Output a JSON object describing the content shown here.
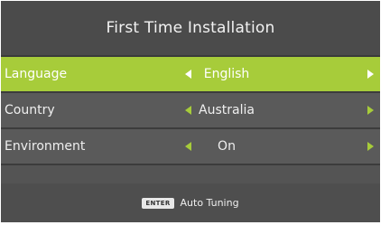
{
  "title": "First Time Installation",
  "rows": [
    {
      "label": "Language",
      "value": "English",
      "selected": true
    },
    {
      "label": "Country",
      "value": "Australia",
      "selected": false
    },
    {
      "label": "Environment",
      "value": "On",
      "selected": false
    }
  ],
  "footer": {
    "key_label": "ENTER",
    "action_label": "Auto Tuning"
  },
  "colors": {
    "panel": "#545454",
    "highlight": "#a7cc3a",
    "text": "#efefef"
  }
}
